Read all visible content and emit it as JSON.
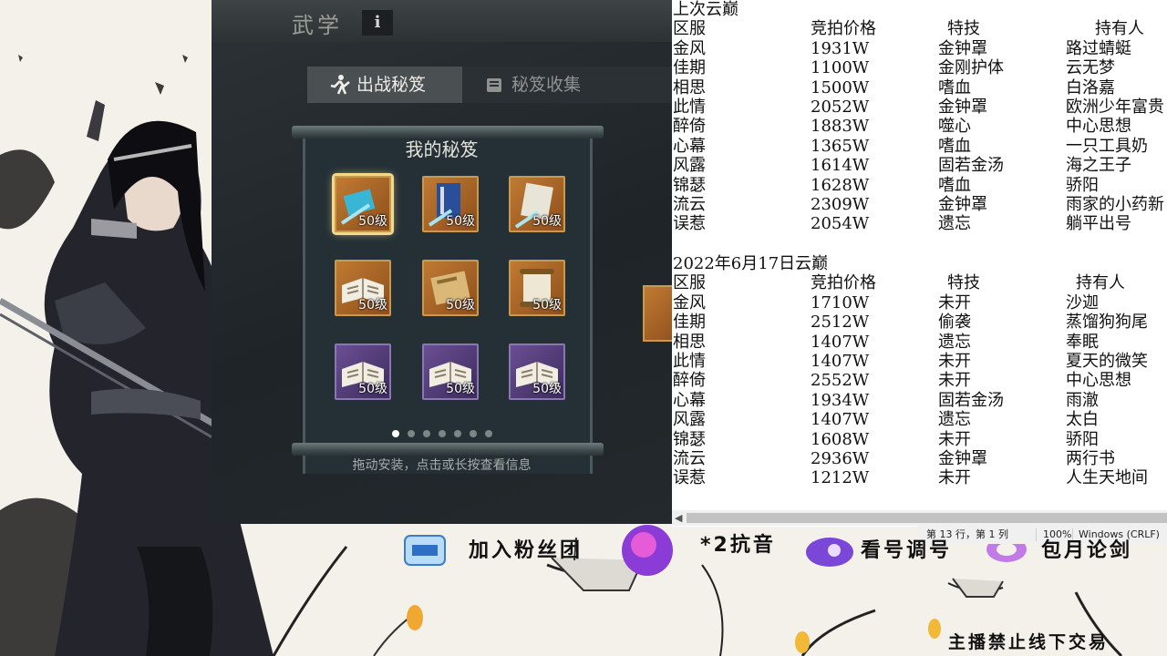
{
  "game": {
    "title": "武学",
    "info_label": "i",
    "tabs": [
      {
        "label": "出战秘笈",
        "active": true
      },
      {
        "label": "秘笈收集",
        "active": false
      }
    ],
    "panel_title": "我的秘笈",
    "slots": [
      {
        "level": "50级",
        "rarity": "gold",
        "icon": "blue-manual-sword-icon",
        "selected": true
      },
      {
        "level": "50级",
        "rarity": "gold",
        "icon": "blue-book-sword-icon",
        "selected": false
      },
      {
        "level": "50级",
        "rarity": "gold",
        "icon": "scroll-sword-icon",
        "selected": false
      },
      {
        "level": "50级",
        "rarity": "gold",
        "icon": "open-book-icon",
        "selected": false
      },
      {
        "level": "50级",
        "rarity": "gold",
        "icon": "tan-scroll-icon",
        "selected": false
      },
      {
        "level": "50级",
        "rarity": "gold",
        "icon": "unrolled-scroll-icon",
        "selected": false
      },
      {
        "level": "50级",
        "rarity": "purple",
        "icon": "open-book-icon",
        "selected": false
      },
      {
        "level": "50级",
        "rarity": "purple",
        "icon": "open-book-icon",
        "selected": false
      },
      {
        "level": "50级",
        "rarity": "purple",
        "icon": "open-book-icon",
        "selected": false
      }
    ],
    "page_count": 7,
    "active_page": 1,
    "hint": "拖动安装，点击或长按查看信息"
  },
  "notepad": {
    "section1": {
      "heading": "上次云巅",
      "columns": [
        "区服",
        "竞拍价格",
        "特技",
        "持有人"
      ],
      "rows": [
        [
          "金风",
          "1931W",
          "金钟罩",
          "路过蜻蜓"
        ],
        [
          "佳期",
          "1100W",
          "金刚护体",
          "云无梦"
        ],
        [
          "相思",
          "1500W",
          "嗜血",
          "白洛嘉"
        ],
        [
          "此情",
          "2052W",
          "金钟罩",
          "欧洲少年富贵"
        ],
        [
          "醉倚",
          "1883W",
          "噬心",
          "中心思想"
        ],
        [
          "心幕",
          "1365W",
          "嗜血",
          "一只工具奶"
        ],
        [
          "风露",
          "1614W",
          "固若金汤",
          "海之王子"
        ],
        [
          "锦瑟",
          "1628W",
          "嗜血",
          "骄阳"
        ],
        [
          "流云",
          "2309W",
          "金钟罩",
          "雨家的小药新"
        ],
        [
          "误惹",
          "2054W",
          "遗忘",
          "躺平出号"
        ]
      ]
    },
    "section2": {
      "heading": "2022年6月17日云巅",
      "columns": [
        "区服",
        "竞拍价格",
        "特技",
        "持有人"
      ],
      "rows": [
        [
          "金风",
          "1710W",
          "未开",
          "沙迦"
        ],
        [
          "佳期",
          "2512W",
          "偷袭",
          "蒸馏狗狗尾"
        ],
        [
          "相思",
          "1407W",
          "遗忘",
          "奉眠"
        ],
        [
          "此情",
          "1407W",
          "未开",
          "夏天的微笑"
        ],
        [
          "醉倚",
          "2552W",
          "未开",
          "中心思想"
        ],
        [
          "心幕",
          "1934W",
          "固若金汤",
          "雨澈"
        ],
        [
          "风露",
          "1407W",
          "遗忘",
          "太白"
        ],
        [
          "锦瑟",
          "1608W",
          "未开",
          "骄阳"
        ],
        [
          "流云",
          "2936W",
          "金钟罩",
          "两行书"
        ],
        [
          "误惹",
          "1212W",
          "未开",
          "人生天地间"
        ]
      ]
    },
    "status": {
      "position": "第 13 行，第 1 列",
      "zoom": "100%",
      "encoding": "Windows (CRLF)"
    }
  },
  "banner": {
    "items": [
      "加入粉丝团",
      "*2抗音",
      "看号调号",
      "包月论剑"
    ],
    "footer": "主播禁止线下交易"
  },
  "colors": {
    "notepad_bg": "#ffffff",
    "game_bg": "#23292c",
    "gold_slot": "#c07a32",
    "purple_slot": "#6a4f93"
  }
}
